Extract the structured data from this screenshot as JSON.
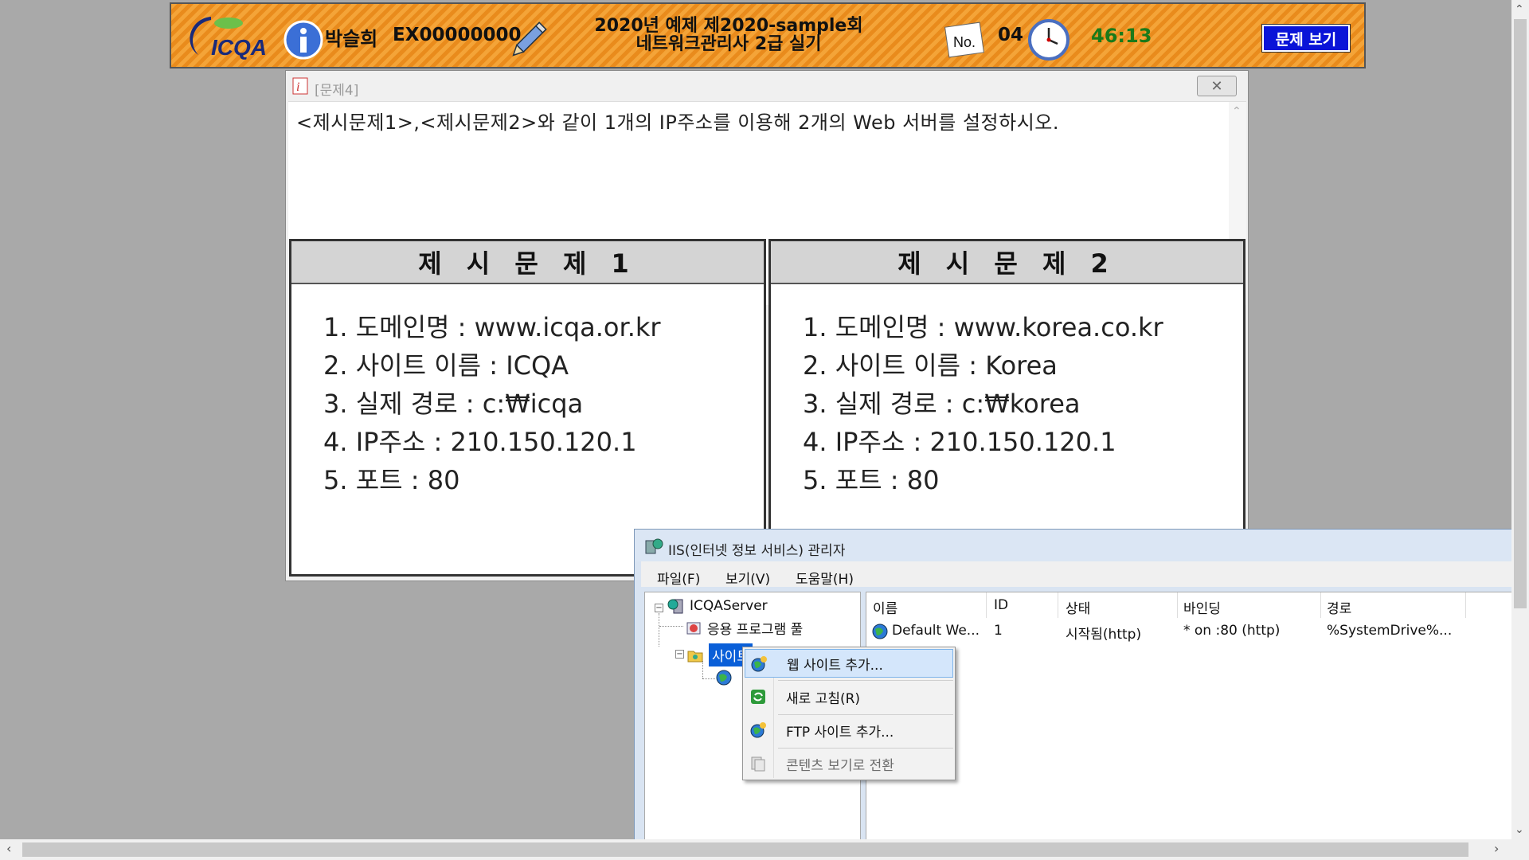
{
  "banner": {
    "logo_text": "ICQA",
    "candidate_name": "박슬희",
    "candidate_id": "EX00000000",
    "exam_title_line1": "2020년 예제 제2020-sample회",
    "exam_title_line2": "네트워크관리사 2급 실기",
    "no_label": "No.",
    "question_no": "04",
    "timer": "46:13",
    "view_button": "문제 보기"
  },
  "question_window": {
    "title": "[문제4]",
    "close_glyph": "✕",
    "question_text": "<제시문제1>,<제시문제2>와 같이 1개의 IP주소를 이용해 2개의 Web 서버를 설정하시오.",
    "panels": [
      {
        "header": "제 시 문 제 1",
        "items": [
          "1. 도메인명 : www.icqa.or.kr",
          "2. 사이트 이름 : ICQA",
          "3. 실제 경로 : c:₩icqa",
          "4. IP주소 : 210.150.120.1",
          "5. 포트 : 80"
        ]
      },
      {
        "header": "제 시 문 제 2",
        "items": [
          "1. 도메인명 : www.korea.co.kr",
          "2. 사이트 이름 : Korea",
          "3. 실제 경로 : c:₩korea",
          "4. IP주소 : 210.150.120.1",
          "5. 포트 : 80"
        ]
      }
    ]
  },
  "iis": {
    "title": "IIS(인터넷 정보 서비스) 관리자",
    "menu": [
      "파일(F)",
      "보기(V)",
      "도움말(H)"
    ],
    "tree": {
      "server": "ICQAServer",
      "app_pool": "응용 프로그램 풀",
      "sites": "사이트"
    },
    "columns": [
      "이름",
      "ID",
      "상태",
      "바인딩",
      "경로"
    ],
    "rows": [
      [
        "Default We...",
        "1",
        "시작됨(http)",
        "* on :80 (http)",
        "%SystemDrive%..."
      ]
    ]
  },
  "context_menu": {
    "items": [
      "웹 사이트 추가...",
      "새로 고침(R)",
      "FTP 사이트 추가...",
      "콘텐츠 보기로 전환"
    ]
  }
}
